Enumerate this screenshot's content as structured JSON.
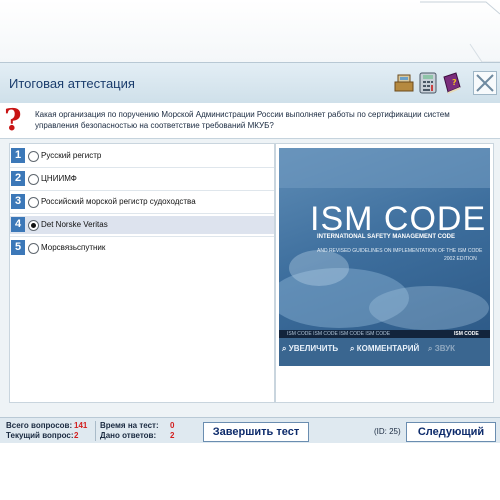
{
  "window": {
    "title": "Итоговая аттестация"
  },
  "question": {
    "text": "Какая организация по поручению Морской Администрации России выполняет работы по сертификации систем управления безопасностью на соответствие требований МКУБ?"
  },
  "answers": [
    {
      "number": "1",
      "label": "Русский регистр",
      "selected": false
    },
    {
      "number": "2",
      "label": "ЦНИИМФ",
      "selected": false
    },
    {
      "number": "3",
      "label": "Российский морской регистр судоходства",
      "selected": false
    },
    {
      "number": "4",
      "label": "Det Norske Veritas",
      "selected": true
    },
    {
      "number": "5",
      "label": "Морсвязьспутник",
      "selected": false
    }
  ],
  "image_panel": {
    "cover_title": "ISM CODE",
    "cover_subtitle": "INTERNATIONAL SAFETY MANAGEMENT CODE",
    "cover_guidelines": "AND REVISED GUIDELINES ON IMPLEMENTATION OF THE ISM CODE",
    "cover_edition": "2002 EDITION",
    "cover_stripe_text": "ISM CODE ISM CODE ISM CODE ISM CODE",
    "cover_stripe_highlight": "ISM CODE",
    "zoom_label": "УВЕЛИЧИТЬ",
    "comment_label": "КОММЕНТАРИЙ",
    "sound_label": "ЗВУК"
  },
  "status": {
    "total_questions_label": "Всего вопросов:",
    "total_questions_value": "141",
    "current_question_label": "Текущий вопрос:",
    "current_question_value": "2",
    "time_label": "Время на тест:",
    "time_value": "0",
    "answered_label": "Дано ответов:",
    "answered_value": "2",
    "finish_label": "Завершить тест",
    "id_text": "(ID: 25)",
    "next_label": "Следующий"
  },
  "colors": {
    "title": "#1b3d6d",
    "question_mark": "#c81414",
    "answer_number_bg": "#3c78b8",
    "status_value": "#d21e1e",
    "cover_blue": "#3d6e9d"
  },
  "icons": [
    "cash-register-icon",
    "calculator-icon",
    "book-icon",
    "close-icon",
    "search-icon",
    "comment-icon",
    "sound-icon"
  ]
}
